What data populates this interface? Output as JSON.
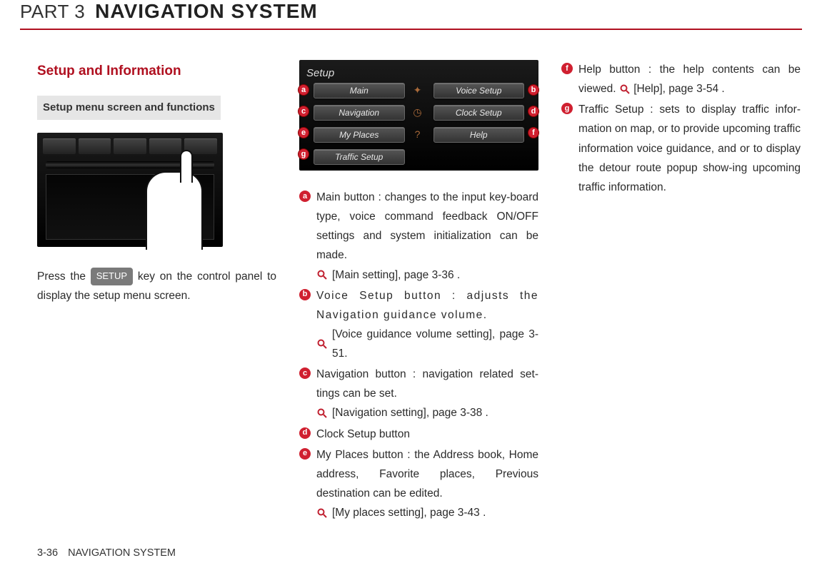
{
  "header": {
    "part_label": "PART 3",
    "part_title": "NAVIGATION SYSTEM"
  },
  "col1": {
    "section_title": "Setup and Information",
    "sub_header": "Setup menu screen and functions",
    "press_pre": "Press the ",
    "setup_key": "SETUP",
    "press_post": " key on the control panel to display the setup menu screen."
  },
  "setup_screen": {
    "title": "Setup",
    "buttons": {
      "a": "Main",
      "b": "Voice Setup",
      "c": "Navigation",
      "d": "Clock Setup",
      "e": "My Places",
      "f": "Help",
      "g": "Traffic Setup"
    }
  },
  "items": {
    "a": {
      "text": "Main button : changes to the input key-board type, voice command feedback ON/OFF settings and system initialization can be made.",
      "ref": "[Main setting], page 3-36 ."
    },
    "b": {
      "text": "Voice Setup button : adjusts the Navigation guidance volume.",
      "ref": "[Voice guidance volume setting], page 3-51."
    },
    "c": {
      "text": "Navigation button : navigation related set-tings can be set.",
      "ref": "[Navigation setting], page 3-38 ."
    },
    "d": {
      "text": "Clock Setup button"
    },
    "e": {
      "text": "My Places button : the Address book, Home address, Favorite places, Previous destination can be edited.",
      "ref": "[My places setting], page 3-43 ."
    },
    "f": {
      "text_pre": "Help button : the help contents can be viewed.",
      "ref_inline": "[Help], page 3-54 ."
    },
    "g": {
      "text": "Traffic Setup : sets to display traffic infor-mation on map, or to provide upcoming traffic information voice guidance, and or to display the detour route popup show-ing upcoming traffic information."
    }
  },
  "footer": {
    "page_number": "3-36",
    "section_name": "NAVIGATION SYSTEM"
  }
}
